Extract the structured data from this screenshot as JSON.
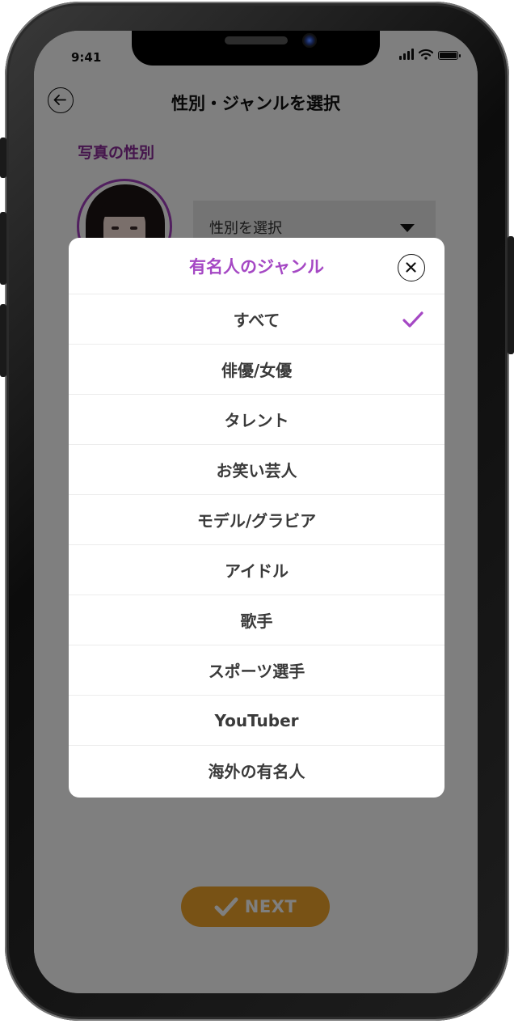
{
  "status_bar": {
    "time": "9:41"
  },
  "header": {
    "title": "性別・ジャンルを選択"
  },
  "photo_section": {
    "label": "写真の性別"
  },
  "gender_select": {
    "placeholder": "性別を選択"
  },
  "next_button": {
    "label": "NEXT"
  },
  "modal": {
    "title": "有名人のジャンル",
    "selected_index": 0,
    "items": [
      {
        "label": "すべて"
      },
      {
        "label": "俳優/女優"
      },
      {
        "label": "タレント"
      },
      {
        "label": "お笑い芸人"
      },
      {
        "label": "モデル/グラビア"
      },
      {
        "label": "アイドル"
      },
      {
        "label": "歌手"
      },
      {
        "label": "スポーツ選手"
      },
      {
        "label": "YouTuber"
      },
      {
        "label": "海外の有名人"
      }
    ]
  },
  "colors": {
    "accent": "#a548c4",
    "section_label": "#8a2a99",
    "next_button": "#f0a52a"
  }
}
